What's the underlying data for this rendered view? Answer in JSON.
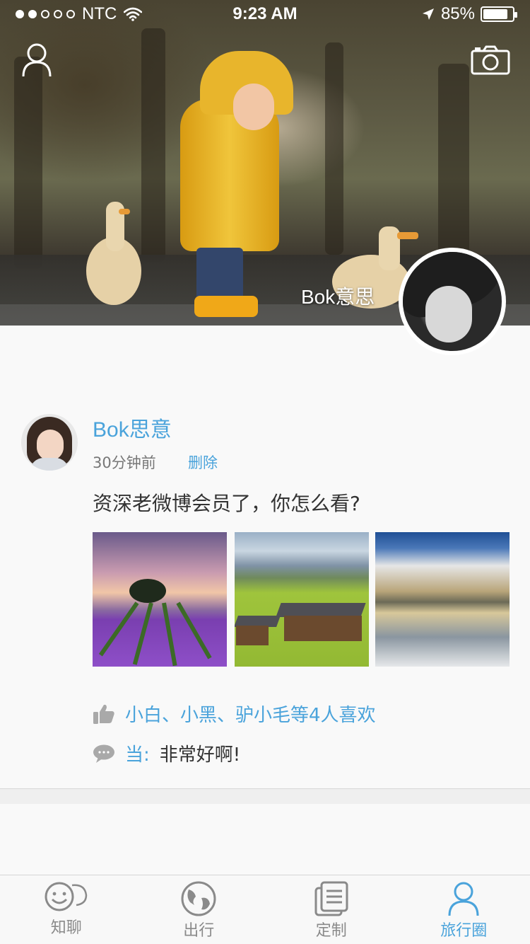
{
  "status_bar": {
    "carrier": "NTC",
    "time": "9:23 AM",
    "battery": "85%",
    "battery_level": 0.85
  },
  "profile": {
    "cover_username": "Bok意思"
  },
  "post": {
    "author": "Bok思意",
    "time": "30分钟前",
    "delete_label": "删除",
    "text": "资深老微博会员了，你怎么看?",
    "photos": [
      "lavender-field-photo",
      "mountain-cabins-photo",
      "lake-clouds-photo"
    ],
    "likes": "小白、小黑、驴小毛等4人喜欢",
    "comments": [
      {
        "author": "当:",
        "text": "非常好啊!"
      }
    ]
  },
  "tabbar": {
    "items": [
      {
        "label": "知聊",
        "icon": "chat-face-icon",
        "active": false
      },
      {
        "label": "出行",
        "icon": "globe-icon",
        "active": false
      },
      {
        "label": "定制",
        "icon": "document-icon",
        "active": false
      },
      {
        "label": "旅行圈",
        "icon": "person-icon",
        "active": true
      }
    ]
  },
  "colors": {
    "accent": "#4aa3db",
    "inactive": "#8a8a8a"
  }
}
